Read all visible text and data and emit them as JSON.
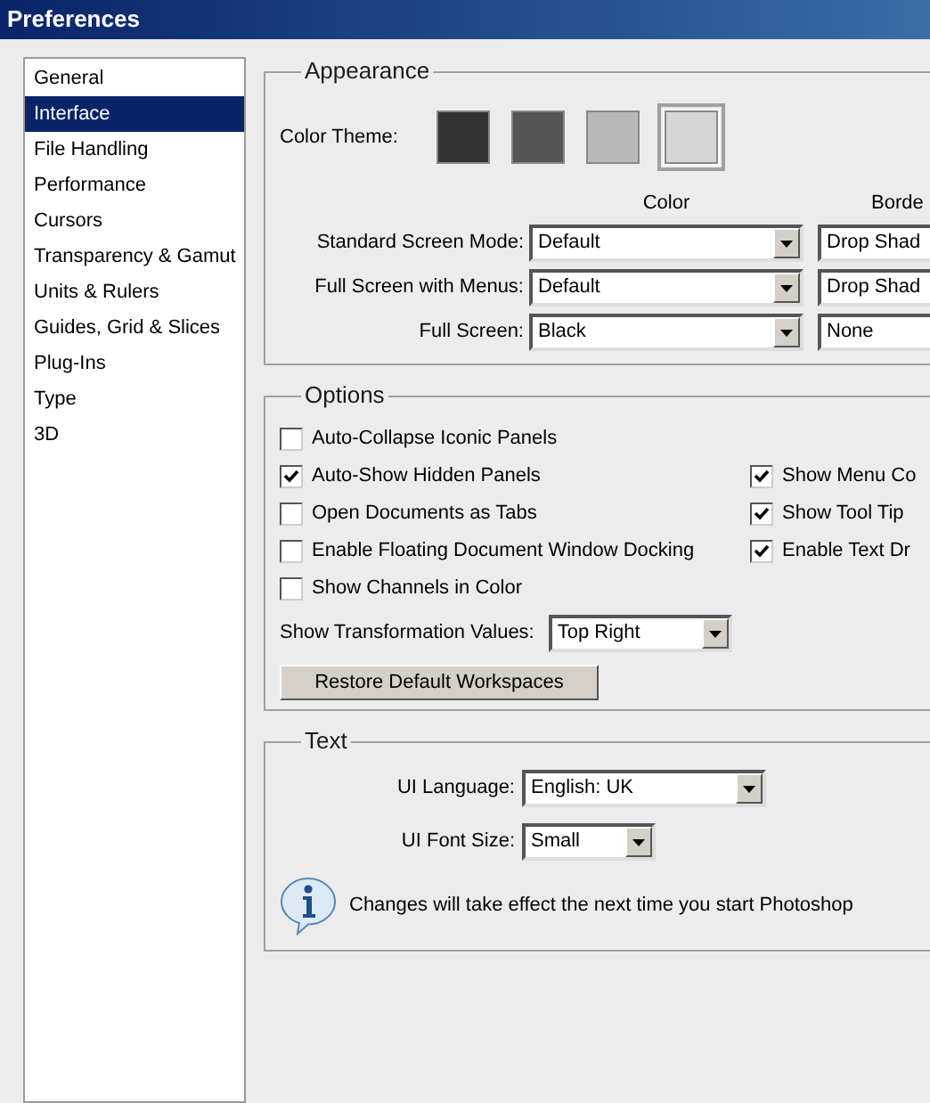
{
  "window": {
    "title": "Preferences"
  },
  "sidebar": {
    "items": [
      {
        "label": "General",
        "selected": false
      },
      {
        "label": "Interface",
        "selected": true
      },
      {
        "label": "File Handling",
        "selected": false
      },
      {
        "label": "Performance",
        "selected": false
      },
      {
        "label": "Cursors",
        "selected": false
      },
      {
        "label": "Transparency & Gamut",
        "selected": false
      },
      {
        "label": "Units & Rulers",
        "selected": false
      },
      {
        "label": "Guides, Grid & Slices",
        "selected": false
      },
      {
        "label": "Plug-Ins",
        "selected": false
      },
      {
        "label": "Type",
        "selected": false
      },
      {
        "label": "3D",
        "selected": false
      }
    ]
  },
  "appearance": {
    "title": "Appearance",
    "color_theme": {
      "label": "Color Theme:",
      "swatches": [
        {
          "color": "#333333",
          "selected": false
        },
        {
          "color": "#555555",
          "selected": false
        },
        {
          "color": "#b8b8b8",
          "selected": false
        },
        {
          "color": "#d6d6d6",
          "selected": true
        }
      ]
    },
    "columns": [
      "Color",
      "Borde"
    ],
    "rows": [
      {
        "label": "Standard Screen Mode:",
        "values": [
          "Default",
          "Drop Shad"
        ]
      },
      {
        "label": "Full Screen with Menus:",
        "values": [
          "Default",
          "Drop Shad"
        ]
      },
      {
        "label": "Full Screen:",
        "values": [
          "Black",
          "None"
        ]
      }
    ]
  },
  "options": {
    "title": "Options",
    "left": [
      {
        "label": "Auto-Collapse Iconic Panels",
        "checked": false
      },
      {
        "label": "Auto-Show Hidden Panels",
        "checked": true
      },
      {
        "label": "Open Documents as Tabs",
        "checked": false
      },
      {
        "label": "Enable Floating Document Window Docking",
        "checked": false
      },
      {
        "label": "Show Channels in Color",
        "checked": false
      }
    ],
    "right": [
      {
        "label": "Show Menu Co",
        "checked": true
      },
      {
        "label": "Show Tool Tip",
        "checked": true
      },
      {
        "label": "Enable Text Dr",
        "checked": true
      }
    ],
    "transformation": {
      "label": "Show Transformation Values:",
      "value": "Top Right"
    },
    "button": "Restore Default Workspaces"
  },
  "text": {
    "title": "Text",
    "ui_language": {
      "label": "UI Language:",
      "value": "English: UK"
    },
    "ui_font_size": {
      "label": "UI Font Size:",
      "value": "Small"
    },
    "info": "Changes will take effect the next time you start Photoshop"
  }
}
